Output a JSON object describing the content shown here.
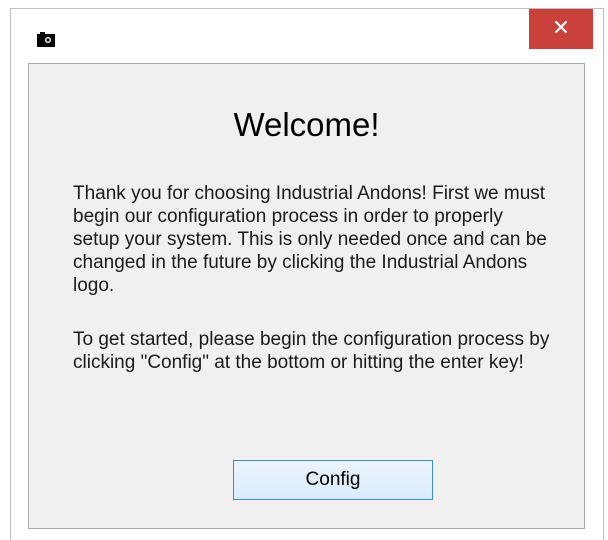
{
  "dialog": {
    "heading": "Welcome!",
    "paragraph_1": "Thank you for choosing Industrial Andons! First we must begin our configuration process in order to properly setup your system. This is only needed once and can be changed in the future by clicking the Industrial Andons logo.",
    "paragraph_2": "To get started, please begin the configuration process by clicking \"Config\" at the bottom or hitting the enter key!",
    "config_button_label": "Config"
  },
  "titlebar": {
    "app_icon": "camera-icon",
    "close_icon": "close-icon",
    "close_button_color": "#c9413a"
  }
}
